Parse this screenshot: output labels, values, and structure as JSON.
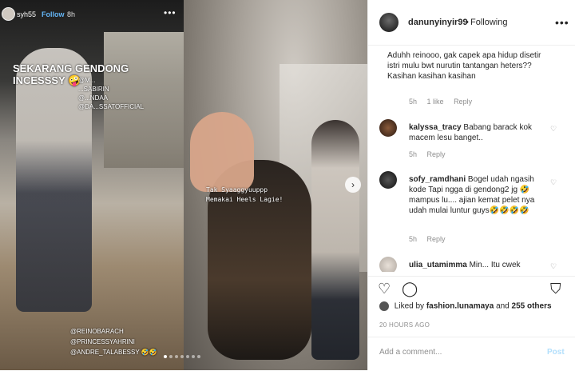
{
  "story": {
    "username": "syh55",
    "follow_label": "Follow",
    "time": "8h",
    "more": "•••",
    "overlay_text": "SEKARANG GENDONG INCESSSY 🤪",
    "tags": [
      "@M...",
      "...SABIRIN",
      "@...NDAA",
      "@DA...SSATOFFICIAL"
    ],
    "bottom_tags": [
      "@REINOBARACH @PRINCESSYAHRINI",
      "@ANDRE_TALABESSY 🤣🤣"
    ],
    "right_caption": [
      "Tak Syaaggyuuppp",
      "Memakai Heels Lagie!"
    ]
  },
  "next_label": "›",
  "header": {
    "username": "danunyinyir99",
    "dot": "•",
    "following": "Following",
    "more": "•••"
  },
  "comments": [
    {
      "text": "Aduhh reinooo, gak capek apa hidup disetir istri mulu bwt nurutin tantangan heters?? Kasihan kasihan kasihan",
      "meta": [
        "5h",
        "1 like",
        "Reply"
      ]
    },
    {
      "user": "kalyssa_tracy",
      "text": "Babang barack kok macem lesu banget..",
      "meta": [
        "5h",
        "Reply"
      ]
    },
    {
      "user": "sofy_ramdhani",
      "text": "Bogel udah ngasih kode Tapi ngga di gendong2 jg 🤣 mampus lu.... ajian kemat pelet nya udah mulai luntur guys🤣🤣🤣🤣",
      "meta": [
        "5h",
        "Reply"
      ]
    },
    {
      "user": "ulia_utamimma",
      "text": "Min... Itu cwek",
      "meta": []
    }
  ],
  "actions": {
    "heart": "♡",
    "comment": "◯",
    "save": "⛉"
  },
  "likes": {
    "prefix": "Liked by",
    "user": "fashion.lunamaya",
    "and": "and",
    "others": "255 others"
  },
  "time_ago": "20 HOURS AGO",
  "add_comment": {
    "placeholder": "Add a comment...",
    "post": "Post"
  }
}
